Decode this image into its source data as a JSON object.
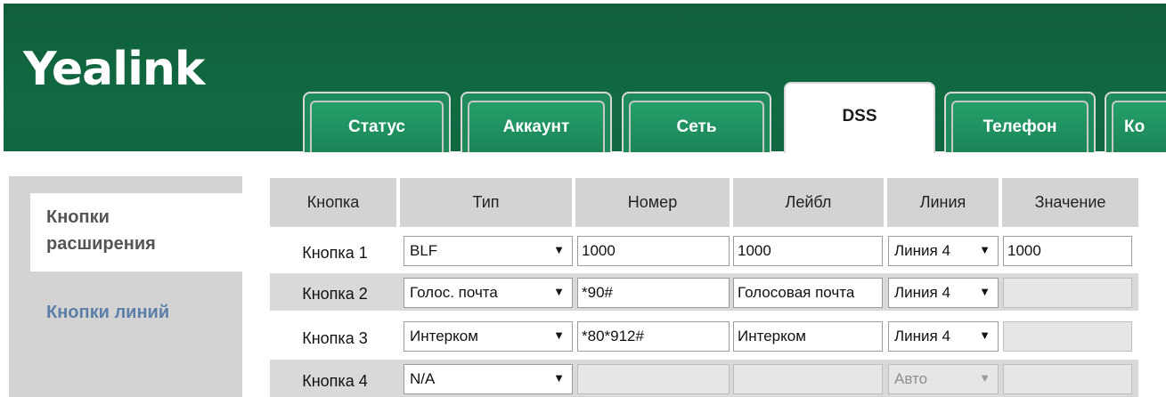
{
  "brand": {
    "logo": "Yealink"
  },
  "tabs": [
    {
      "label": "Статус",
      "active": false
    },
    {
      "label": "Аккаунт",
      "active": false
    },
    {
      "label": "Сеть",
      "active": false
    },
    {
      "label": "DSS",
      "active": true
    },
    {
      "label": "Телефон",
      "active": false
    },
    {
      "label": "Ко",
      "active": false
    }
  ],
  "sidebar": {
    "items": [
      {
        "label": "Кнопки\nрасширения",
        "active": true
      },
      {
        "label": "Кнопки линий",
        "active": false
      }
    ]
  },
  "table": {
    "headers": [
      "Кнопка",
      "Тип",
      "Номер",
      "Лейбл",
      "Линия",
      "Значение"
    ],
    "rows": [
      {
        "button": "Кнопка 1",
        "type": "BLF",
        "number": "1000",
        "label": "1000",
        "line": "Линия 4",
        "value": "1000"
      },
      {
        "button": "Кнопка 2",
        "type": "Голос. почта",
        "number": "*90#",
        "label": "Голосовая почта",
        "line": "Линия 4",
        "value": ""
      },
      {
        "button": "Кнопка 3",
        "type": "Интерком",
        "number": "*80*912#",
        "label": "Интерком",
        "line": "Линия 4",
        "value": ""
      },
      {
        "button": "Кнопка 4",
        "type": "N/A",
        "number": "",
        "label": "",
        "line": "Авто",
        "value": ""
      }
    ]
  },
  "colors": {
    "header_green": "#116a42",
    "tab_green": "#1f8a5c",
    "nav_link": "#5b7fa6"
  }
}
